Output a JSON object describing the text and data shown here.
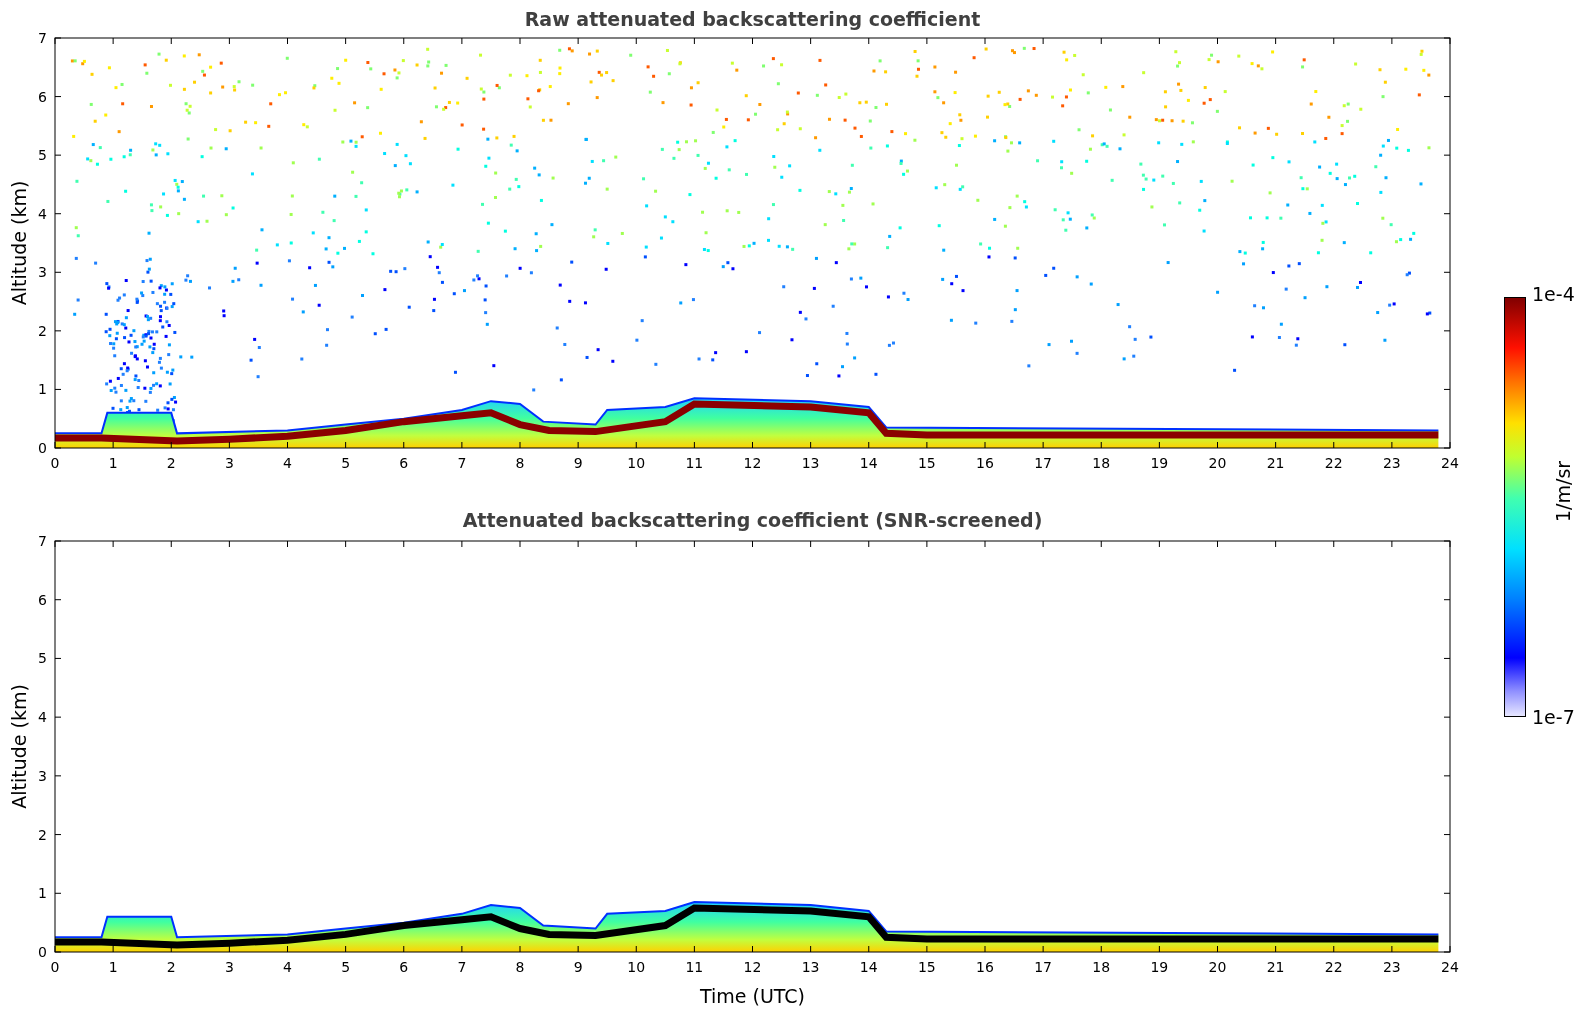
{
  "plots": [
    {
      "kind": "raw",
      "title": "Raw attenuated backscattering coefficient",
      "ylabel": "Altitude (km)",
      "yticks": [
        "7",
        "6",
        "5",
        "4",
        "3",
        "2",
        "1",
        "0"
      ],
      "xticks": [
        "0",
        "1",
        "2",
        "3",
        "4",
        "5",
        "6",
        "7",
        "8",
        "9",
        "10",
        "11",
        "12",
        "13",
        "14",
        "15",
        "16",
        "17",
        "18",
        "19",
        "20",
        "21",
        "22",
        "23",
        "24"
      ]
    },
    {
      "kind": "screened",
      "title": "Attenuated backscattering coefficient (SNR-screened)",
      "ylabel": "Altitude (km)",
      "yticks": [
        "7",
        "6",
        "5",
        "4",
        "3",
        "2",
        "1",
        "0"
      ],
      "xticks": [
        "0",
        "1",
        "2",
        "3",
        "4",
        "5",
        "6",
        "7",
        "8",
        "9",
        "10",
        "11",
        "12",
        "13",
        "14",
        "15",
        "16",
        "17",
        "18",
        "19",
        "20",
        "21",
        "22",
        "23",
        "24"
      ],
      "xlabel": "Time (UTC)"
    }
  ],
  "colorbar": {
    "max_label": "1e-4",
    "min_label": "1e-7",
    "unit_label": "1/m/sr"
  }
}
